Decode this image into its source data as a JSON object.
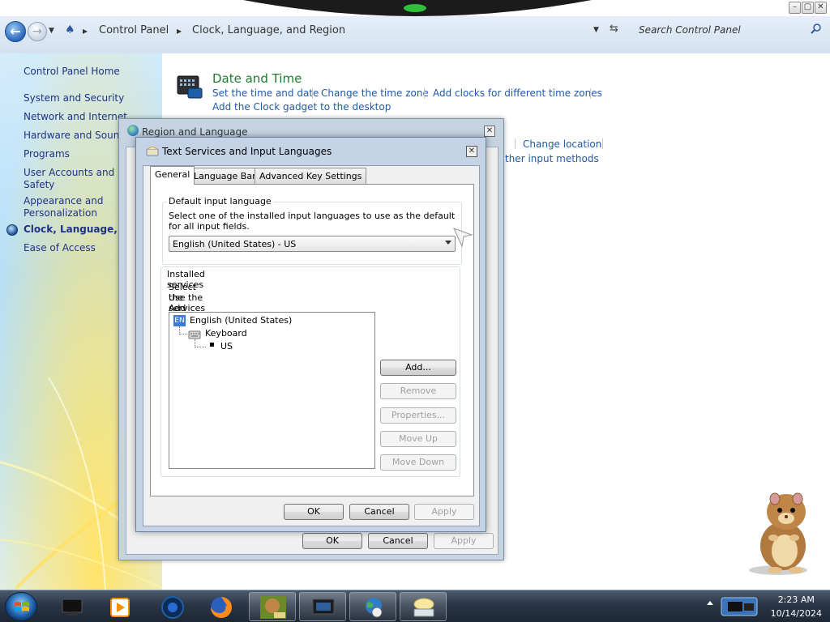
{
  "explorer": {
    "window_controls": [
      "min",
      "max",
      "close"
    ],
    "breadcrumb": [
      "Control Panel",
      "Clock, Language, and Region"
    ],
    "search_placeholder": "Search Control Panel"
  },
  "sidebar": {
    "items": [
      {
        "label": "Control Panel Home"
      },
      {
        "label": "System and Security"
      },
      {
        "label": "Network and Internet"
      },
      {
        "label": "Hardware and Sound"
      },
      {
        "label": "Programs"
      },
      {
        "label": "User Accounts and Fa",
        "label2": "Safety"
      },
      {
        "label": "Appearance and",
        "label2": "Personalization"
      },
      {
        "label": "Clock, Language, and"
      },
      {
        "label": "Ease of Access"
      }
    ]
  },
  "main": {
    "date_time": {
      "title": "Date and Time",
      "links": [
        "Set the time and date",
        "Change the time zone",
        "Add clocks for different time zones",
        "Add the Clock gadget to the desktop"
      ]
    },
    "region_links": [
      "Change location",
      "ther input methods"
    ]
  },
  "region_dialog": {
    "title": "Region and Language",
    "buttons": {
      "ok": "OK",
      "cancel": "Cancel",
      "apply": "Apply"
    }
  },
  "text_services_dialog": {
    "title": "Text Services and Input Languages",
    "tabs": [
      "General",
      "Language Bar",
      "Advanced Key Settings"
    ],
    "default_input": {
      "group_label": "Default input language",
      "description": "Select one of the installed input languages to use as the default for all input fields.",
      "selected": "English (United States) - US"
    },
    "installed": {
      "group_label": "Installed services",
      "description_line1": "Select the services that you want for each input language shown in the list.",
      "description_line2": "Use the Add and Remove buttons to modify this list.",
      "tree": {
        "badge": "EN",
        "language": "English (United States)",
        "category": "Keyboard",
        "service": "US"
      }
    },
    "side_buttons": {
      "add": "Add...",
      "remove": "Remove",
      "properties": "Properties...",
      "move_up": "Move Up",
      "move_down": "Move Down"
    },
    "buttons": {
      "ok": "OK",
      "cancel": "Cancel",
      "apply": "Apply"
    }
  },
  "taskbar": {
    "clock_time": "2:23 AM",
    "clock_date": "10/14/2024"
  }
}
